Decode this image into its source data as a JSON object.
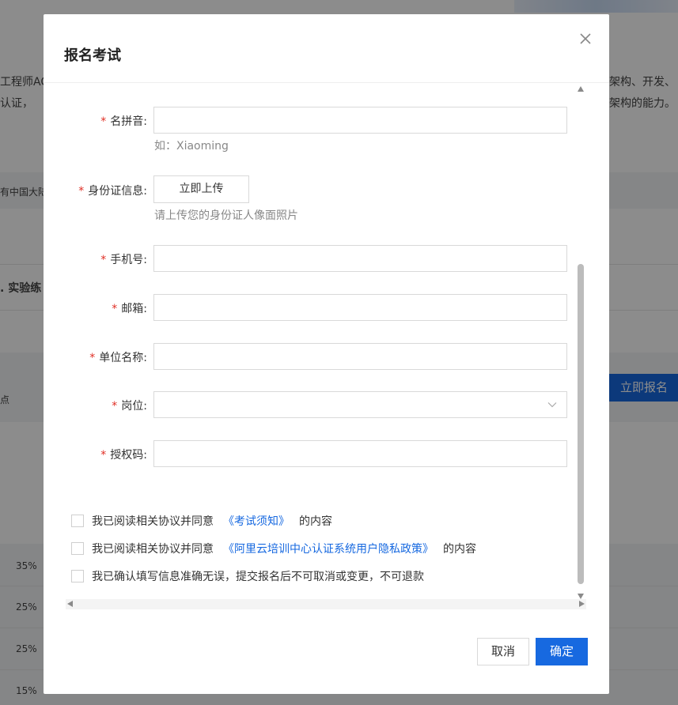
{
  "background": {
    "fragments": {
      "left_line1": "工程师AC",
      "left_line2": "认证，",
      "right_line1": "架构、开发、",
      "right_line2": "架构的能力。",
      "left_strip": "有中国大陆",
      "section_heading": ". 实验练",
      "side_char": "点"
    },
    "register_button": "立即报名",
    "percentages": [
      "35%",
      "25%",
      "25%",
      "15%"
    ]
  },
  "modal": {
    "title": "报名考试",
    "fields": {
      "name_pinyin": {
        "label": "名拼音:",
        "hint": "如：Xiaoming",
        "value": ""
      },
      "id_info": {
        "label": "身份证信息:",
        "button": "立即上传",
        "hint": "请上传您的身份证人像面照片"
      },
      "phone": {
        "label": "手机号:",
        "value": ""
      },
      "email": {
        "label": "邮箱:",
        "value": ""
      },
      "company": {
        "label": "单位名称:",
        "value": ""
      },
      "position": {
        "label": "岗位:",
        "value": ""
      },
      "auth_code": {
        "label": "授权码:",
        "value": ""
      }
    },
    "agreements": [
      {
        "prefix": "我已阅读相关协议并同意",
        "link": "《考试须知》",
        "suffix": "的内容"
      },
      {
        "prefix": "我已阅读相关协议并同意",
        "link": "《阿里云培训中心认证系统用户隐私政策》",
        "suffix": "的内容"
      },
      {
        "prefix": "我已确认填写信息准确无误，提交报名后不可取消或变更，不可退款"
      }
    ],
    "cancel_label": "取消",
    "confirm_label": "确定"
  },
  "colors": {
    "accent": "#1769e0",
    "required": "#e02e24",
    "overlay": "rgba(0,0,0,0.45)"
  },
  "icons": [
    "close-icon",
    "chevron-down-icon"
  ]
}
